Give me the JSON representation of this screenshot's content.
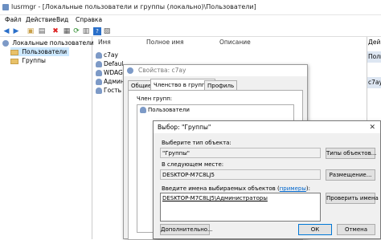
{
  "window": {
    "title": "lusrmgr - [Локальные пользователи и группы (локально)\\Пользователи]"
  },
  "menu": [
    "Файл",
    "Действие",
    "Вид",
    "Справка"
  ],
  "tree": {
    "root": "Локальные пользователи и гр",
    "children": [
      "Пользователи",
      "Группы"
    ]
  },
  "list": {
    "columns": [
      "Имя",
      "Полное имя",
      "Описание"
    ],
    "rows": [
      "c7ay",
      "Defaul",
      "WDAG",
      "Админ",
      "Гость"
    ]
  },
  "right_panel": {
    "header1": "Дей",
    "header2": "Поль",
    "header3": "c7ay"
  },
  "props": {
    "title": "Свойства: c7ay",
    "tabs": [
      "Общие",
      "Членство в группах",
      "Профиль"
    ],
    "member_of_label": "Член групп:",
    "groups": [
      "Пользователи"
    ]
  },
  "select_dialog": {
    "title": "Выбор: \"Группы\"",
    "object_type_label": "Выберите тип объекта:",
    "object_type_value": "\"Группы\"",
    "object_types_button": "Типы объектов...",
    "location_label": "В следующем месте:",
    "location_value": "DESKTOP-M7C8LJ5",
    "location_button": "Размещение...",
    "names_label_prefix": "Введите имена выбираемых объектов (",
    "names_label_link": "примеры",
    "names_label_suffix": "):",
    "names_value": "DESKTOP-M7C8LJ5\\Администраторы",
    "check_names_button": "Проверить имена",
    "advanced_button": "Дополнительно...",
    "ok_button": "ОК",
    "cancel_button": "Отмена"
  }
}
